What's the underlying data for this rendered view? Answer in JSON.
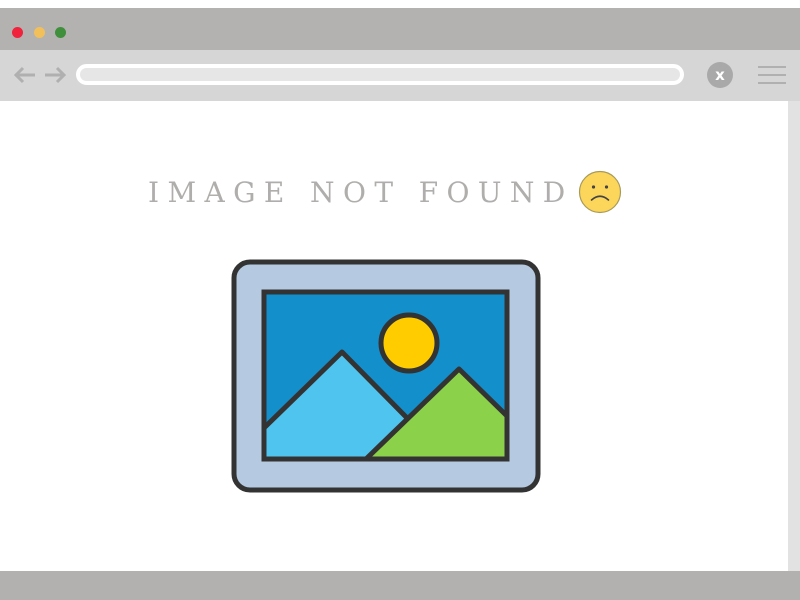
{
  "window": {
    "controls": [
      {
        "name": "close-window-dot",
        "color": "#f0223c"
      },
      {
        "name": "minimize-window-dot",
        "color": "#f2c05a"
      },
      {
        "name": "zoom-window-dot",
        "color": "#3f8f3c"
      }
    ]
  },
  "toolbar": {
    "back_icon": "arrow-left-icon",
    "forward_icon": "arrow-right-icon",
    "address": "",
    "stop_label": "x",
    "menu_icon": "hamburger-icon"
  },
  "page": {
    "message": "IMAGE NOT FOUND",
    "message_icon": "sad-face-icon",
    "illustration": "image-placeholder-icon"
  },
  "colors": {
    "chrome": "#b4b2b0",
    "toolbar": "#d6d6d6",
    "message_text": "#b0aeac",
    "face": "#fbd65b",
    "frame": "#b5cae0",
    "sky": "#138fcc",
    "sun": "#ffcc00",
    "mountain_left": "#4fc4ee",
    "mountain_right": "#8bd149",
    "outline": "#333333"
  }
}
